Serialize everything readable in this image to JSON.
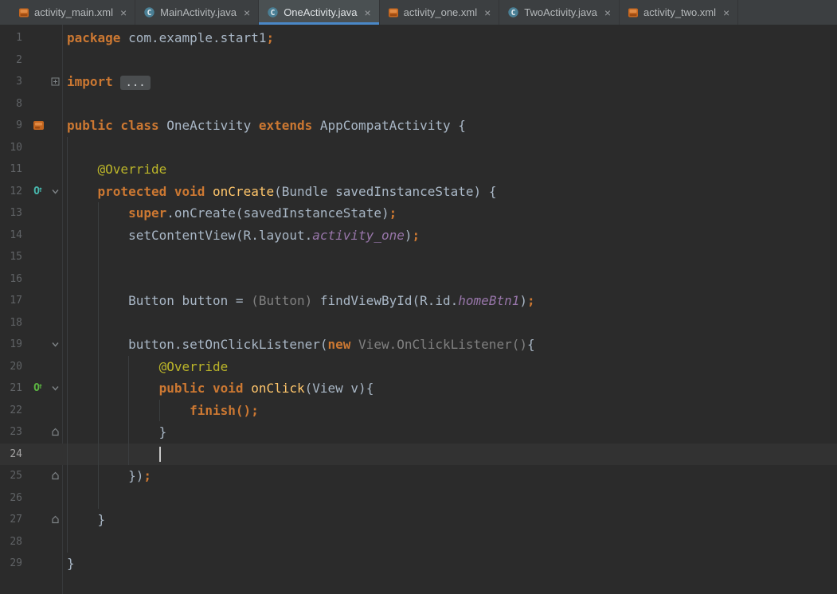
{
  "window": {
    "background": "#2b2b2b"
  },
  "tabbar": {
    "background": "#3c3f41",
    "close_icon": "×",
    "tabs": [
      {
        "label": "activity_main.xml",
        "icon": "xml-file-icon",
        "selected": false
      },
      {
        "label": "MainActivity.java",
        "icon": "java-class-icon",
        "selected": false
      },
      {
        "label": "OneActivity.java",
        "icon": "java-class-icon",
        "selected": true
      },
      {
        "label": "activity_one.xml",
        "icon": "xml-file-icon",
        "selected": false
      },
      {
        "label": "TwoActivity.java",
        "icon": "java-class-icon",
        "selected": false
      },
      {
        "label": "activity_two.xml",
        "icon": "xml-file-icon",
        "selected": false
      }
    ]
  },
  "colors": {
    "keyword": "#cc7832",
    "plain": "#a9b7c6",
    "method_declaration": "#ffc66b",
    "annotation": "#bbb529",
    "resource_field": "#9876aa",
    "muted": "#808080",
    "line_number": "#606366",
    "active_line_number": "#a4a3a3",
    "active_line_bg": "#323232",
    "tab_underline": "#4a88c7",
    "override_marker_teal": "#48b8ae",
    "override_marker_green": "#5cb842"
  },
  "editor": {
    "lines": [
      {
        "num": "1",
        "segs": [
          [
            "kw",
            "package "
          ],
          [
            "pl",
            "com.example.start1"
          ],
          [
            "kw",
            ";"
          ]
        ],
        "guides": []
      },
      {
        "num": "2",
        "segs": [],
        "guides": []
      },
      {
        "num": "3",
        "fold": "collapsed",
        "segs": [
          [
            "kw",
            "import "
          ],
          [
            "chip",
            "..."
          ]
        ],
        "guides": []
      },
      {
        "num": "8",
        "segs": [],
        "guides": []
      },
      {
        "num": "9",
        "icon": "android-class-icon",
        "segs": [
          [
            "kw",
            "public class "
          ],
          [
            "pl",
            "OneActivity "
          ],
          [
            "kw",
            "extends "
          ],
          [
            "pl",
            "AppCompatActivity {"
          ]
        ],
        "guides": []
      },
      {
        "num": "10",
        "segs": [],
        "guides": [
          0
        ]
      },
      {
        "num": "11",
        "segs": [
          [
            "pl",
            "    "
          ],
          [
            "ann",
            "@Override"
          ]
        ],
        "guides": [
          0
        ]
      },
      {
        "num": "12",
        "icon": "override-teal-icon",
        "fold": "open",
        "segs": [
          [
            "pl",
            "    "
          ],
          [
            "kw",
            "protected void "
          ],
          [
            "mth",
            "onCreate"
          ],
          [
            "pl",
            "(Bundle savedInstanceState) {"
          ]
        ],
        "guides": [
          0
        ]
      },
      {
        "num": "13",
        "segs": [
          [
            "pl",
            "        "
          ],
          [
            "kw",
            "super"
          ],
          [
            "pl",
            ".onCreate(savedInstanceState)"
          ],
          [
            "kw",
            ";"
          ]
        ],
        "guides": [
          0,
          4
        ]
      },
      {
        "num": "14",
        "segs": [
          [
            "pl",
            "        setContentView(R.layout."
          ],
          [
            "fld",
            "activity_one"
          ],
          [
            "pl",
            ")"
          ],
          [
            "kw",
            ";"
          ]
        ],
        "guides": [
          0,
          4
        ]
      },
      {
        "num": "15",
        "segs": [],
        "guides": [
          0,
          4
        ]
      },
      {
        "num": "16",
        "segs": [],
        "guides": [
          0,
          4
        ]
      },
      {
        "num": "17",
        "segs": [
          [
            "pl",
            "        Button button = "
          ],
          [
            "gry",
            "(Button)"
          ],
          [
            "pl",
            " findViewById(R.id."
          ],
          [
            "fld",
            "homeBtn1"
          ],
          [
            "pl",
            ")"
          ],
          [
            "kw",
            ";"
          ]
        ],
        "guides": [
          0,
          4
        ]
      },
      {
        "num": "18",
        "segs": [],
        "guides": [
          0,
          4
        ]
      },
      {
        "num": "19",
        "fold": "open",
        "segs": [
          [
            "pl",
            "        button.setOnClickListener("
          ],
          [
            "kw",
            "new "
          ],
          [
            "gry",
            "View.OnClickListener()"
          ],
          [
            "pl",
            "{"
          ]
        ],
        "guides": [
          0,
          4
        ]
      },
      {
        "num": "20",
        "segs": [
          [
            "pl",
            "            "
          ],
          [
            "ann",
            "@Override"
          ]
        ],
        "guides": [
          0,
          4,
          8
        ]
      },
      {
        "num": "21",
        "icon": "override-green-icon",
        "fold": "open",
        "segs": [
          [
            "pl",
            "            "
          ],
          [
            "kw",
            "public void "
          ],
          [
            "mth",
            "onClick"
          ],
          [
            "pl",
            "(View v){"
          ]
        ],
        "guides": [
          0,
          4,
          8
        ]
      },
      {
        "num": "22",
        "segs": [
          [
            "pl",
            "                "
          ],
          [
            "kw",
            "finish();"
          ]
        ],
        "guides": [
          0,
          4,
          8,
          12
        ]
      },
      {
        "num": "23",
        "fold": "end",
        "segs": [
          [
            "pl",
            "            }"
          ]
        ],
        "guides": [
          0,
          4,
          8
        ]
      },
      {
        "num": "24",
        "active": true,
        "caret_col": 12,
        "segs": [],
        "guides": [
          0,
          4,
          8
        ]
      },
      {
        "num": "25",
        "fold": "end",
        "segs": [
          [
            "pl",
            "        })"
          ],
          [
            "kw",
            ";"
          ]
        ],
        "guides": [
          0,
          4
        ]
      },
      {
        "num": "26",
        "segs": [],
        "guides": [
          0,
          4
        ]
      },
      {
        "num": "27",
        "fold": "end",
        "segs": [
          [
            "pl",
            "    }"
          ]
        ],
        "guides": [
          0
        ]
      },
      {
        "num": "28",
        "segs": [],
        "guides": [
          0
        ]
      },
      {
        "num": "29",
        "segs": [
          [
            "pl",
            "}"
          ]
        ],
        "guides": []
      }
    ]
  }
}
